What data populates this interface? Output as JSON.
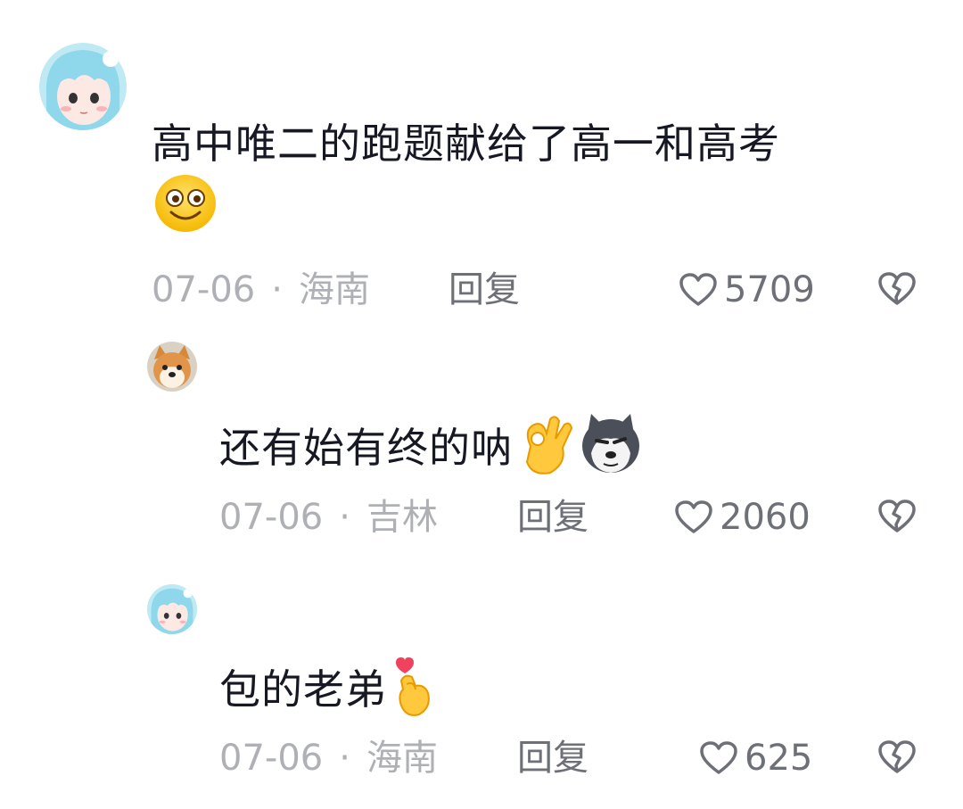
{
  "comments": [
    {
      "text": "高中唯二的跑题献给了高一和高考",
      "emoji": [
        "smiling-face-icon"
      ],
      "date": "07-06",
      "separator": "·",
      "location": "海南",
      "reply_label": "回复",
      "likes": "5709",
      "avatar": "anime-girl-avatar"
    },
    {
      "text": "还有始有终的呐",
      "emoji": [
        "ok-hand-icon",
        "husky-dog-icon"
      ],
      "date": "07-06",
      "separator": "·",
      "location": "吉林",
      "reply_label": "回复",
      "likes": "2060",
      "avatar": "shiba-dog-avatar"
    },
    {
      "text": "包的老弟",
      "emoji": [
        "finger-heart-icon"
      ],
      "date": "07-06",
      "separator": "·",
      "location": "海南",
      "reply_label": "回复",
      "likes": "625",
      "avatar": "anime-girl-avatar"
    }
  ],
  "colors": {
    "primary_text": "#161823",
    "secondary_text": "#aeb0b5",
    "action_text": "#6e7077",
    "avatar_hair": "#8fd8ec"
  }
}
